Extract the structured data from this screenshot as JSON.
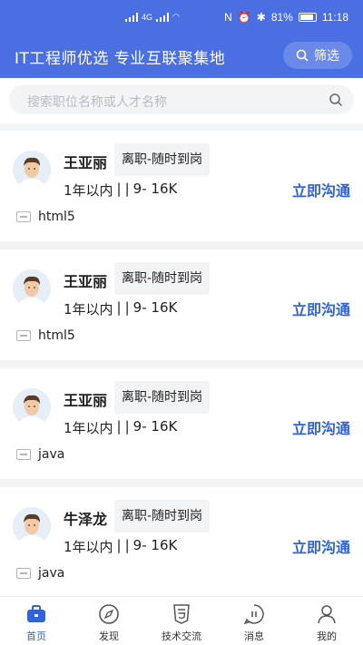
{
  "status_bar": {
    "time": "11:18",
    "battery": "81%",
    "network": "4G"
  },
  "header": {
    "title": "IT工程师优选 专业互联聚集地",
    "filter_label": "筛选"
  },
  "search": {
    "placeholder": "搜索职位名称或人才名称"
  },
  "candidates": [
    {
      "name": "王亚丽",
      "status": "离职-随时到岗",
      "experience": "1年以内",
      "sep1": "|",
      "sep2": "|",
      "salary": "9- 16K",
      "action": "立即沟通",
      "skill": "html5"
    },
    {
      "name": "王亚丽",
      "status": "离职-随时到岗",
      "experience": "1年以内",
      "sep1": "|",
      "sep2": "|",
      "salary": "9- 16K",
      "action": "立即沟通",
      "skill": "html5"
    },
    {
      "name": "王亚丽",
      "status": "离职-随时到岗",
      "experience": "1年以内",
      "sep1": "|",
      "sep2": "|",
      "salary": "9- 16K",
      "action": "立即沟通",
      "skill": "java"
    },
    {
      "name": "牛泽龙",
      "status": "离职-随时到岗",
      "experience": "1年以内",
      "sep1": "|",
      "sep2": "|",
      "salary": "9- 16K",
      "action": "立即沟通",
      "skill": "java"
    }
  ],
  "tabbar": {
    "items": [
      {
        "label": "首页",
        "icon": "briefcase-icon",
        "active": true
      },
      {
        "label": "发现",
        "icon": "compass-icon",
        "active": false
      },
      {
        "label": "技术交流",
        "icon": "html5-icon",
        "active": false
      },
      {
        "label": "消息",
        "icon": "chat-bubble-icon",
        "active": false
      },
      {
        "label": "我的",
        "icon": "person-icon",
        "active": false
      }
    ]
  },
  "colors": {
    "brand": "#4a6fe3",
    "accent": "#2f63d6"
  }
}
